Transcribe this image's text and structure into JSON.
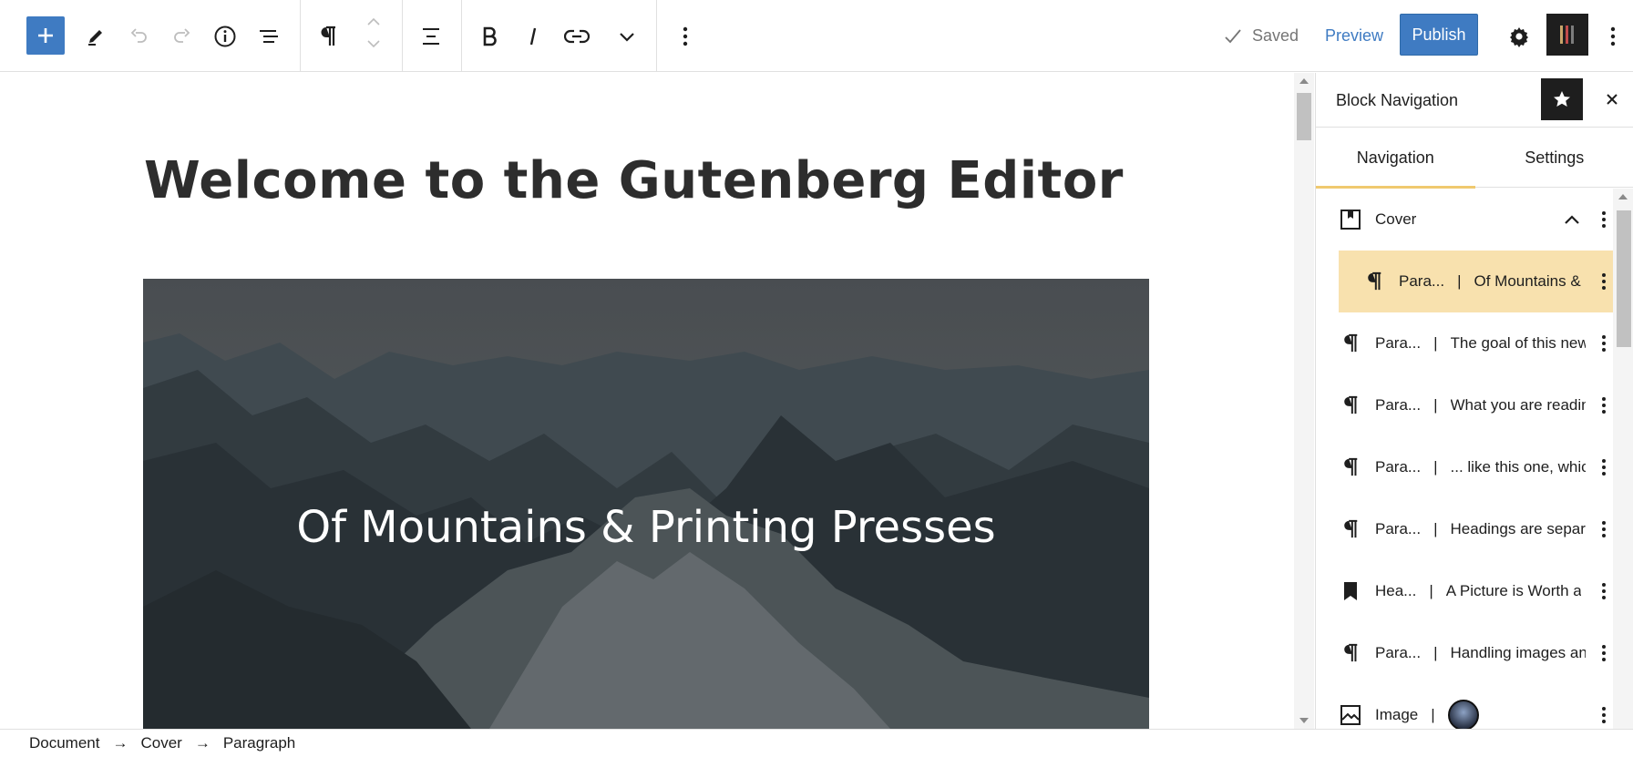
{
  "toolbar": {
    "saved_label": "Saved",
    "preview_label": "Preview",
    "publish_label": "Publish"
  },
  "editor": {
    "title": "Welcome to the Gutenberg Editor",
    "cover_text": "Of Mountains & Printing Presses"
  },
  "breadcrumb": {
    "items": [
      "Document",
      "Cover",
      "Paragraph"
    ],
    "separator": "→"
  },
  "sidebar": {
    "title": "Block Navigation",
    "tabs": [
      "Navigation",
      "Settings"
    ],
    "items": [
      {
        "label": "Cover",
        "snippet": "",
        "icon": "cover-icon"
      },
      {
        "label": "Para...",
        "snippet": "Of Mountains &",
        "icon": "paragraph-icon"
      },
      {
        "label": "Para...",
        "snippet": "The goal of this new",
        "icon": "paragraph-icon"
      },
      {
        "label": "Para...",
        "snippet": "What you are reading",
        "icon": "paragraph-icon"
      },
      {
        "label": "Para...",
        "snippet": "... like this one, which",
        "icon": "paragraph-icon"
      },
      {
        "label": "Para...",
        "snippet": "Headings are separate",
        "icon": "paragraph-icon"
      },
      {
        "label": "Hea...",
        "snippet": "A Picture is Worth a",
        "icon": "bookmark-icon"
      },
      {
        "label": "Para...",
        "snippet": "Handling images and",
        "icon": "paragraph-icon"
      },
      {
        "label": "Image",
        "snippet": "",
        "icon": "image-icon"
      }
    ],
    "bar": "|"
  },
  "colors": {
    "accent": "#3f7bc2",
    "selected_row": "#f8e1ae",
    "tab_underline": "#f0c96f"
  }
}
